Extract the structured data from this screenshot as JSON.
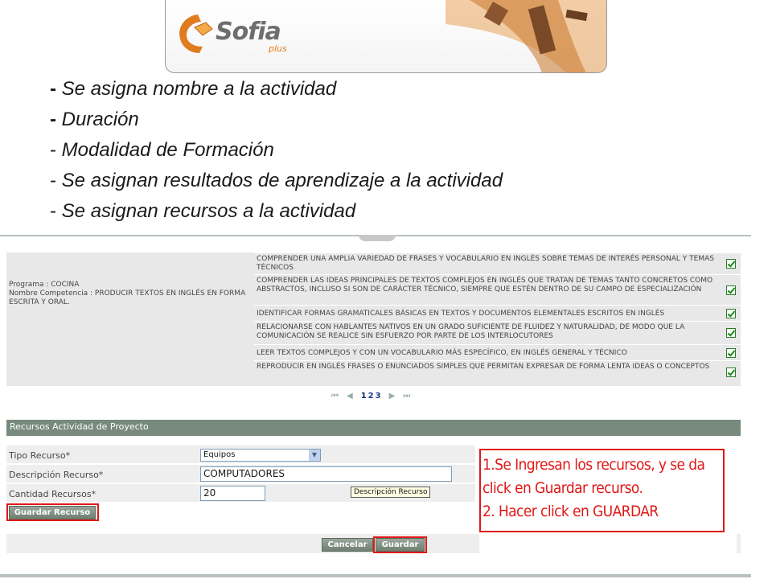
{
  "logo": {
    "brand": "Sofia",
    "suffix": "plus"
  },
  "bullets": [
    {
      "dash": "-",
      "bold": true,
      "text": "Se asigna nombre a la actividad"
    },
    {
      "dash": "-",
      "bold": true,
      "text": "Duración"
    },
    {
      "dash": "-",
      "bold": false,
      "text": "Modalidad de Formación"
    },
    {
      "dash": "-",
      "bold": false,
      "text": "Se asignan resultados de aprendizaje a la actividad"
    },
    {
      "dash": "-",
      "bold": false,
      "text": "Se asignan recursos a la actividad"
    }
  ],
  "program": {
    "programa": "Programa : COCINA",
    "competencia": "Nombre Competencia : PRODUCIR TEXTOS EN INGLÉS EN FORMA ESCRITA Y ORAL."
  },
  "results": [
    {
      "text": "COMPRENDER UNA AMPLIA VARIEDAD DE FRASES Y VOCABULARIO EN INGLÉS SOBRE TEMAS DE INTERÉS PERSONAL Y TEMAS TÉCNICOS",
      "checked": true
    },
    {
      "text": "COMPRENDER LAS IDEAS PRINCIPALES DE TEXTOS COMPLEJOS EN INGLÉS QUE TRATAN DE TEMAS TANTO CONCRETOS COMO ABSTRACTOS, INCLUSO SI SON DE CARÁCTER TÉCNICO, SIEMPRE QUE ESTÉN DENTRO DE SU CAMPO DE ESPECIALIZACIÓN",
      "checked": true
    },
    {
      "text": "IDENTIFICAR FORMAS GRAMATICALES BÁSICAS EN TEXTOS Y DOCUMENTOS ELEMENTALES ESCRITOS EN INGLÉS",
      "checked": true
    },
    {
      "text": "RELACIONARSE CON HABLANTES NATIVOS EN UN GRADO SUFICIENTE DE FLUIDEZ Y NATURALIDAD, DE MODO QUE LA COMUNICACIÓN SE REALICE SIN ESFUERZO POR PARTE DE LOS INTERLOCUTORES",
      "checked": true
    },
    {
      "text": "LEER TEXTOS COMPLEJOS Y CON UN VOCABULARIO MÁS ESPECÍFICO, EN INGLÉS GENERAL Y TÉCNICO",
      "checked": true
    },
    {
      "text": "REPRODUCIR EN INGLÉS FRASES O ENUNCIADOS SIMPLES QUE PERMITAN EXPRESAR DE FORMA LENTA IDEAS O CONCEPTOS",
      "checked": true
    }
  ],
  "pager": {
    "first": "⏮",
    "prev": "◀",
    "pages": [
      "1",
      "2",
      "3"
    ],
    "current": "1",
    "next": "▶",
    "last": "⏭"
  },
  "recursos": {
    "section_title": "Recursos Actividad de Proyecto",
    "tipo_label": "Tipo Recurso*",
    "tipo_value": "Equipos",
    "descripcion_label": "Descripción Recurso*",
    "descripcion_value": "COMPUTADORES",
    "cantidad_label": "Cantidad Recursos*",
    "cantidad_value": "20",
    "tooltip": "Descripción Recurso",
    "guardar_recurso": "Guardar Recurso",
    "cancelar": "Cancelar",
    "guardar": "Guardar"
  },
  "annotation": {
    "line1": "1.Se Ingresan los recursos, y se da",
    "line2": "click en Guardar recurso.",
    "line3": "2. Hacer click en GUARDAR"
  },
  "colors": {
    "section_header": "#778a7d",
    "highlight": "#e01818",
    "annotation_text": "#e01818",
    "logo_orange": "#e07c1f"
  }
}
